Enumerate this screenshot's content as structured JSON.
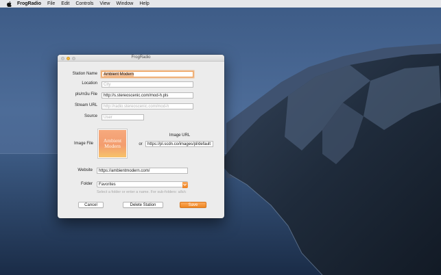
{
  "menubar": {
    "app_name": "FrogRadio",
    "items": [
      "File",
      "Edit",
      "Controls",
      "View",
      "Window",
      "Help"
    ]
  },
  "window": {
    "title": "FrogRadio"
  },
  "form": {
    "station_name": {
      "label": "Station Name",
      "value": "Ambient Modern"
    },
    "location": {
      "label": "Location",
      "placeholder": "City"
    },
    "pls_file": {
      "label": "pls/m3u File",
      "value": "http://s.stereoscenic.com/mod-h.pls"
    },
    "stream_url": {
      "label": "Stream URL",
      "placeholder": "http://radio.stereoscenic.com/mod-h"
    },
    "source": {
      "label": "Source",
      "placeholder": "User"
    },
    "image_file": {
      "label": "Image File",
      "art_line1": "Ambient",
      "art_line2": "Modern"
    },
    "or_label": "or",
    "image_url": {
      "label": "Image URL",
      "value": "https://pl.scdn.co/images/pl/default"
    },
    "website": {
      "label": "Website",
      "value": "https://ambientmodern.com/"
    },
    "folder": {
      "label": "Folder",
      "value": "Favorites",
      "hint": "Select a folder or enter a name. For sub-folders: a/b/c"
    }
  },
  "buttons": {
    "cancel": "Cancel",
    "delete": "Delete Station",
    "save": "Save"
  },
  "colors": {
    "accent": "#f08722",
    "focus_ring": "#f0a35e"
  }
}
